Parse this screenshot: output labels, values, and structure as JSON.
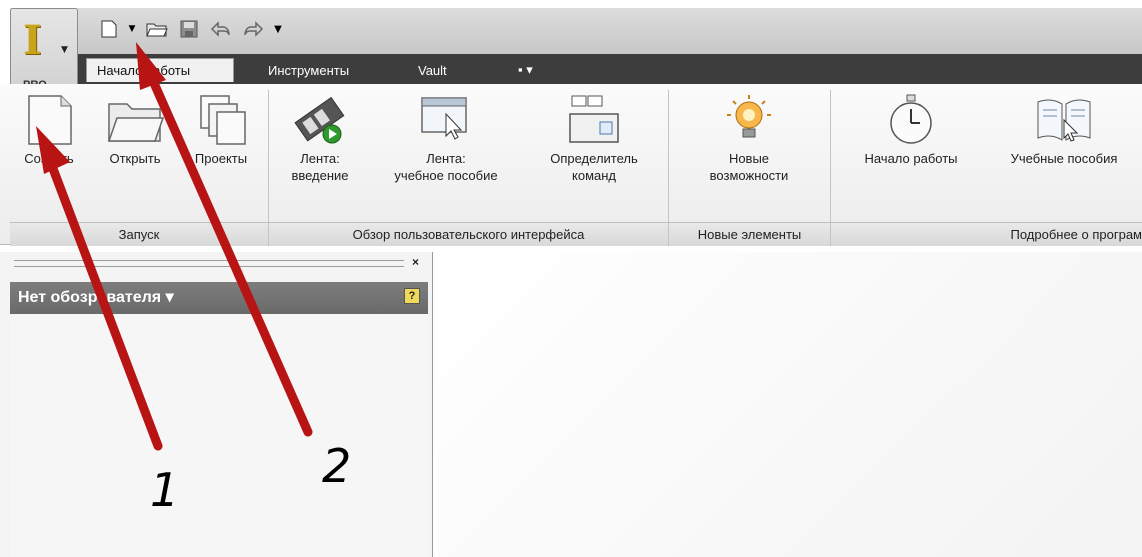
{
  "app": {
    "edition": "PRO"
  },
  "quick_access": {
    "icons": [
      "new-file-icon",
      "dropdown-arrow-icon",
      "open-folder-icon",
      "save-icon",
      "undo-icon",
      "redo-icon",
      "customize-arrow-icon"
    ]
  },
  "tabs": [
    {
      "label": "Начало работы",
      "active": true
    },
    {
      "label": "Инструменты",
      "active": false
    },
    {
      "label": "Vault",
      "active": false
    },
    {
      "label": "▪ ▾",
      "active": false
    }
  ],
  "ribbon": {
    "buttons": [
      {
        "label": "Создать",
        "icon": "new-document-icon"
      },
      {
        "label": "Открыть",
        "icon": "open-folder-icon"
      },
      {
        "label": "Проекты",
        "icon": "projects-icon"
      },
      {
        "label": "Лента:\nвведение",
        "icon": "ribbon-intro-video-icon"
      },
      {
        "label": "Лента:\nучебное пособие",
        "icon": "ribbon-tutorial-icon"
      },
      {
        "label": "Определитель\nкоманд",
        "icon": "command-finder-icon"
      },
      {
        "label": "Новые\nвозможности",
        "icon": "lightbulb-icon"
      },
      {
        "label": "Начало работы",
        "icon": "stopwatch-icon"
      },
      {
        "label": "Учебные пособия",
        "icon": "tutorials-book-icon"
      }
    ],
    "panels": [
      {
        "label": "Запуск"
      },
      {
        "label": "Обзор пользовательского интерфейса"
      },
      {
        "label": "Новые элементы"
      },
      {
        "label": "Подробнее о програм"
      }
    ]
  },
  "browser": {
    "title": "Нет обозревателя ▾",
    "close": "×",
    "help": "?"
  },
  "annotations": {
    "one": "1",
    "two": "2",
    "color": "#c21515"
  }
}
